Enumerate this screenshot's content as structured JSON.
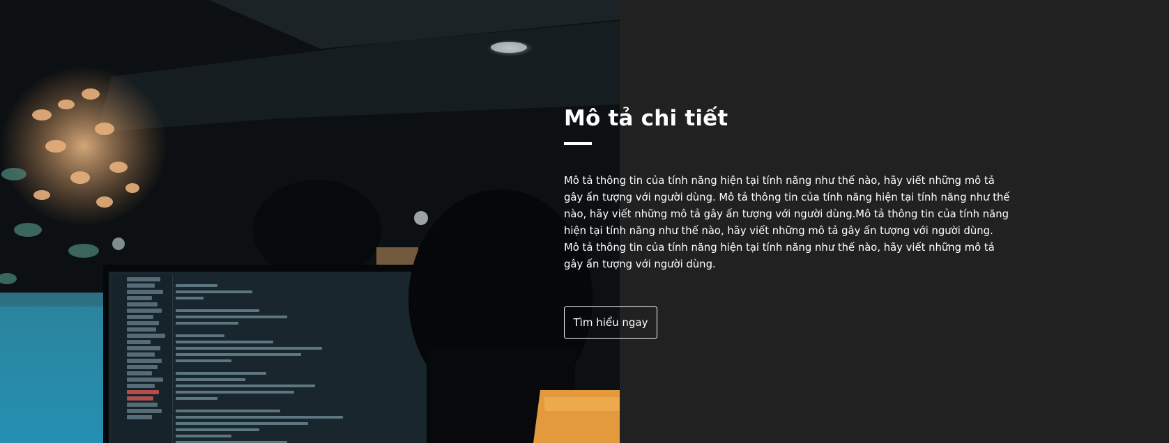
{
  "feature": {
    "title": "Mô tả chi tiết",
    "description": "Mô tả thông tin của tính năng hiện tại tính năng như thế nào, hãy viết những mô tả gây ấn tượng với người dùng. Mô tả thông tin của tính năng hiện tại tính năng như thế nào, hãy viết những mô tả gây ấn tượng với người dùng.Mô tả thông tin của tính năng hiện tại tính năng như thế nào, hãy viết những mô tả gây ấn tượng với người dùng. Mô tả thông tin của tính năng hiện tại tính năng như thế nào, hãy viết những mô tả gây ấn tượng với người dùng.",
    "cta_label": "Tìm hiểu ngay"
  },
  "colors": {
    "panel_background": "#222122",
    "text": "#ffffff",
    "button_border": "#ffffff"
  },
  "image": {
    "icon": "developer-workspace-photo"
  }
}
